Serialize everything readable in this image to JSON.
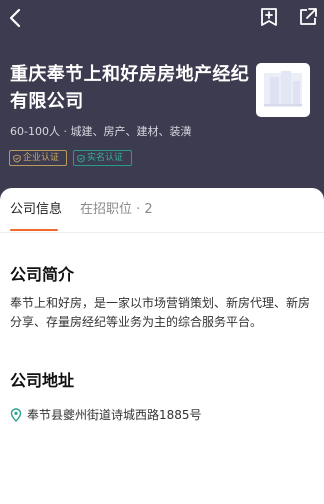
{
  "company": {
    "name": "重庆奉节上和好房房地产经纪有限公司",
    "meta": "60-100人 · 城建、房产、建材、装潢",
    "tags": [
      "企业认证",
      "实名认证"
    ],
    "logo_icon": "building-logo-icon"
  },
  "nav": {
    "back_icon": "chevron-left-icon",
    "collect_icon": "bookmark-add-icon",
    "share_icon": "share-icon"
  },
  "tabs": [
    {
      "label": "公司信息",
      "active": true
    },
    {
      "label": "在招职位 · 2",
      "active": false
    }
  ],
  "intro": {
    "title": "公司简介",
    "text": "奉节上和好房，是一家以市场营销策划、新房代理、新房分享、存量房经纪等业务为主的综合服务平台。"
  },
  "address": {
    "title": "公司地址",
    "text": "奉节县夔州街道诗城西路1885号"
  },
  "colors": {
    "header_bg": "#3d3b4f",
    "accent": "#f26b2c",
    "verified": "#c9a868",
    "realname": "#35b09c"
  }
}
